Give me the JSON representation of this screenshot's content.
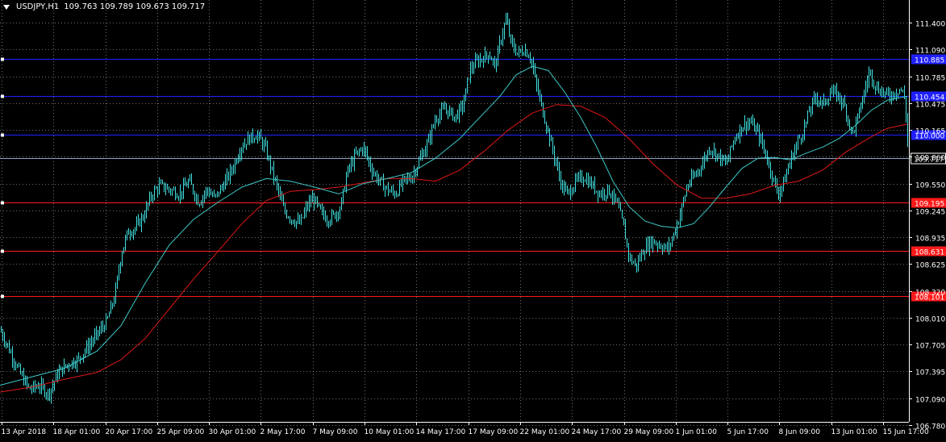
{
  "header": {
    "symbol": "USDJPY,H1",
    "ohlc": "109.763 109.789 109.673 109.717"
  },
  "colors": {
    "background": "#000000",
    "grid": "#c8c8c8",
    "candles": "#40e0e0",
    "ma_fast": "#3cc8c8",
    "ma_slow": "#e01818",
    "support_lines": "#ff1a1a",
    "resistance_lines": "#2020ff",
    "current_price_line": "#8aa0c0"
  },
  "chart_data": {
    "type": "candlestick",
    "title": "USDJPY,H1",
    "ylim": [
      106.62,
      111.58
    ],
    "y_ticks": [
      "111.400",
      "111.090",
      "110.785",
      "110.475",
      "110.165",
      "109.860",
      "109.550",
      "109.245",
      "108.935",
      "108.625",
      "108.320",
      "108.010",
      "107.705",
      "107.395",
      "107.090",
      "106.780"
    ],
    "x_ticks": [
      "13 Apr 2018",
      "18 Apr 01:00",
      "20 Apr 17:00",
      "25 Apr 09:00",
      "30 Apr 01:00",
      "2 May 17:00",
      "7 May 09:00",
      "10 May 01:00",
      "14 May 17:00",
      "17 May 09:00",
      "22 May 01:00",
      "24 May 17:00",
      "29 May 09:00",
      "1 Jun 01:00",
      "5 Jun 17:00",
      "8 Jun 09:00",
      "13 Jun 01:00",
      "15 Jun 17:00"
    ],
    "price_path": [
      [
        0,
        107.7
      ],
      [
        12,
        107.45
      ],
      [
        24,
        107.2
      ],
      [
        36,
        107.0
      ],
      [
        48,
        107.05
      ],
      [
        60,
        106.95
      ],
      [
        72,
        107.2
      ],
      [
        84,
        107.3
      ],
      [
        96,
        107.35
      ],
      [
        108,
        107.5
      ],
      [
        120,
        107.65
      ],
      [
        132,
        107.8
      ],
      [
        142,
        108.1
      ],
      [
        150,
        108.6
      ],
      [
        158,
        108.85
      ],
      [
        168,
        108.9
      ],
      [
        178,
        109.05
      ],
      [
        188,
        109.3
      ],
      [
        198,
        109.4
      ],
      [
        210,
        109.35
      ],
      [
        222,
        109.3
      ],
      [
        234,
        109.45
      ],
      [
        246,
        109.2
      ],
      [
        256,
        109.35
      ],
      [
        266,
        109.25
      ],
      [
        276,
        109.4
      ],
      [
        288,
        109.6
      ],
      [
        298,
        109.85
      ],
      [
        308,
        109.95
      ],
      [
        318,
        110.0
      ],
      [
        328,
        109.85
      ],
      [
        336,
        109.6
      ],
      [
        344,
        109.35
      ],
      [
        352,
        109.1
      ],
      [
        362,
        109.0
      ],
      [
        372,
        108.95
      ],
      [
        380,
        109.15
      ],
      [
        388,
        109.25
      ],
      [
        396,
        109.1
      ],
      [
        406,
        109.0
      ],
      [
        414,
        109.05
      ],
      [
        422,
        109.15
      ],
      [
        430,
        109.55
      ],
      [
        440,
        109.75
      ],
      [
        450,
        109.85
      ],
      [
        460,
        109.6
      ],
      [
        470,
        109.45
      ],
      [
        480,
        109.35
      ],
      [
        490,
        109.3
      ],
      [
        500,
        109.45
      ],
      [
        510,
        109.5
      ],
      [
        520,
        109.7
      ],
      [
        530,
        109.9
      ],
      [
        540,
        110.2
      ],
      [
        552,
        110.3
      ],
      [
        564,
        110.2
      ],
      [
        574,
        110.35
      ],
      [
        582,
        110.75
      ],
      [
        590,
        110.85
      ],
      [
        598,
        110.9
      ],
      [
        606,
        110.95
      ],
      [
        614,
        110.8
      ],
      [
        620,
        111.1
      ],
      [
        627,
        111.35
      ],
      [
        634,
        111.05
      ],
      [
        642,
        110.95
      ],
      [
        650,
        111.0
      ],
      [
        658,
        110.9
      ],
      [
        664,
        110.6
      ],
      [
        672,
        110.3
      ],
      [
        680,
        110.0
      ],
      [
        688,
        109.7
      ],
      [
        696,
        109.4
      ],
      [
        704,
        109.3
      ],
      [
        714,
        109.45
      ],
      [
        724,
        109.5
      ],
      [
        734,
        109.4
      ],
      [
        744,
        109.3
      ],
      [
        754,
        109.35
      ],
      [
        764,
        109.2
      ],
      [
        772,
        108.95
      ],
      [
        780,
        108.55
      ],
      [
        788,
        108.45
      ],
      [
        798,
        108.65
      ],
      [
        808,
        108.75
      ],
      [
        818,
        108.7
      ],
      [
        828,
        108.65
      ],
      [
        836,
        108.85
      ],
      [
        844,
        109.1
      ],
      [
        852,
        109.4
      ],
      [
        860,
        109.5
      ],
      [
        870,
        109.65
      ],
      [
        880,
        109.85
      ],
      [
        890,
        109.75
      ],
      [
        900,
        109.65
      ],
      [
        910,
        109.95
      ],
      [
        920,
        110.1
      ],
      [
        930,
        110.15
      ],
      [
        940,
        110.0
      ],
      [
        948,
        109.8
      ],
      [
        956,
        109.55
      ],
      [
        964,
        109.3
      ],
      [
        972,
        109.45
      ],
      [
        980,
        109.7
      ],
      [
        988,
        109.9
      ],
      [
        996,
        110.05
      ],
      [
        1004,
        110.3
      ],
      [
        1012,
        110.45
      ],
      [
        1020,
        110.35
      ],
      [
        1030,
        110.5
      ],
      [
        1040,
        110.45
      ],
      [
        1048,
        110.3
      ],
      [
        1056,
        110.0
      ],
      [
        1062,
        110.15
      ],
      [
        1070,
        110.45
      ],
      [
        1078,
        110.75
      ],
      [
        1086,
        110.55
      ],
      [
        1094,
        110.5
      ],
      [
        1102,
        110.45
      ],
      [
        1110,
        110.5
      ],
      [
        1116,
        110.55
      ],
      [
        1122,
        110.4
      ],
      [
        1126,
        109.72
      ]
    ],
    "ma_fast_path": [
      [
        0,
        107.05
      ],
      [
        40,
        107.15
      ],
      [
        80,
        107.25
      ],
      [
        120,
        107.45
      ],
      [
        150,
        107.75
      ],
      [
        180,
        108.25
      ],
      [
        210,
        108.7
      ],
      [
        240,
        109.0
      ],
      [
        270,
        109.2
      ],
      [
        300,
        109.38
      ],
      [
        330,
        109.48
      ],
      [
        360,
        109.45
      ],
      [
        390,
        109.38
      ],
      [
        420,
        109.3
      ],
      [
        450,
        109.42
      ],
      [
        480,
        109.48
      ],
      [
        510,
        109.55
      ],
      [
        540,
        109.72
      ],
      [
        570,
        109.95
      ],
      [
        600,
        110.25
      ],
      [
        620,
        110.45
      ],
      [
        640,
        110.7
      ],
      [
        660,
        110.8
      ],
      [
        680,
        110.75
      ],
      [
        700,
        110.5
      ],
      [
        720,
        110.2
      ],
      [
        740,
        109.85
      ],
      [
        760,
        109.45
      ],
      [
        780,
        109.15
      ],
      [
        800,
        108.98
      ],
      [
        820,
        108.92
      ],
      [
        840,
        108.9
      ],
      [
        860,
        108.95
      ],
      [
        880,
        109.15
      ],
      [
        900,
        109.38
      ],
      [
        920,
        109.6
      ],
      [
        940,
        109.72
      ],
      [
        960,
        109.73
      ],
      [
        980,
        109.7
      ],
      [
        1000,
        109.78
      ],
      [
        1020,
        109.85
      ],
      [
        1040,
        109.95
      ],
      [
        1060,
        110.1
      ],
      [
        1080,
        110.28
      ],
      [
        1100,
        110.4
      ],
      [
        1125,
        110.45
      ]
    ],
    "ma_slow_path": [
      [
        0,
        106.97
      ],
      [
        40,
        107.03
      ],
      [
        80,
        107.12
      ],
      [
        120,
        107.2
      ],
      [
        150,
        107.35
      ],
      [
        180,
        107.6
      ],
      [
        210,
        107.95
      ],
      [
        240,
        108.3
      ],
      [
        270,
        108.62
      ],
      [
        300,
        108.95
      ],
      [
        330,
        109.22
      ],
      [
        360,
        109.33
      ],
      [
        390,
        109.35
      ],
      [
        420,
        109.38
      ],
      [
        450,
        109.43
      ],
      [
        480,
        109.48
      ],
      [
        510,
        109.48
      ],
      [
        540,
        109.45
      ],
      [
        570,
        109.58
      ],
      [
        600,
        109.8
      ],
      [
        630,
        110.05
      ],
      [
        660,
        110.25
      ],
      [
        690,
        110.35
      ],
      [
        720,
        110.33
      ],
      [
        750,
        110.2
      ],
      [
        780,
        109.95
      ],
      [
        810,
        109.65
      ],
      [
        840,
        109.4
      ],
      [
        870,
        109.25
      ],
      [
        900,
        109.25
      ],
      [
        930,
        109.3
      ],
      [
        960,
        109.4
      ],
      [
        990,
        109.45
      ],
      [
        1020,
        109.58
      ],
      [
        1050,
        109.8
      ],
      [
        1080,
        109.97
      ],
      [
        1100,
        110.07
      ],
      [
        1125,
        110.12
      ]
    ],
    "horizontal_levels": [
      {
        "value": 110.885,
        "label": "110.885",
        "kind": "resistance"
      },
      {
        "value": 110.454,
        "label": "110.454",
        "kind": "resistance"
      },
      {
        "value": 110.0,
        "label": "110.000",
        "kind": "resistance"
      },
      {
        "value": 109.195,
        "label": "109.195",
        "kind": "support"
      },
      {
        "value": 108.631,
        "label": "108.631",
        "kind": "support"
      },
      {
        "value": 108.101,
        "label": "108.101",
        "kind": "support"
      }
    ],
    "current_price": {
      "value": 109.717,
      "label": "109.717"
    }
  }
}
